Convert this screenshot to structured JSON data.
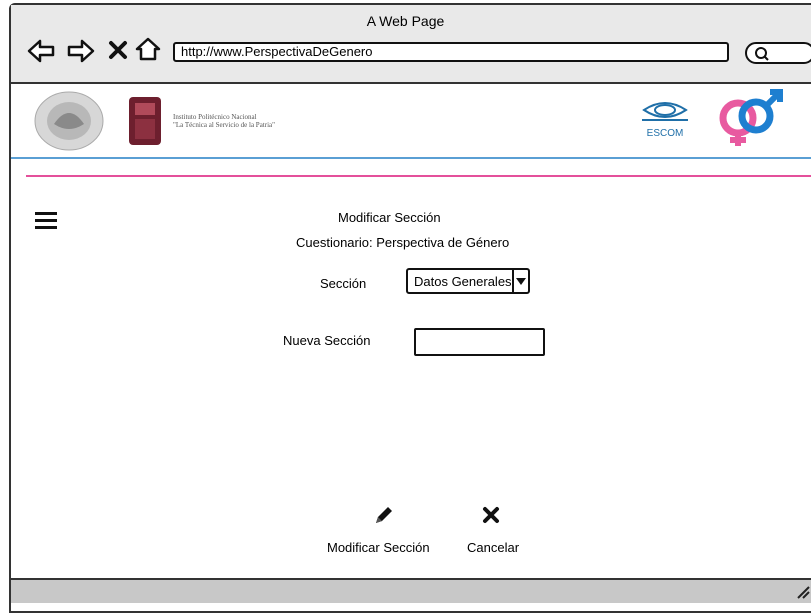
{
  "window": {
    "title": "A Web Page",
    "url": "http://www.PerspectivaDeGenero"
  },
  "header": {
    "institution_line1": "Instituto Politécnico Nacional",
    "institution_line2": "\"La Técnica al Servicio de la Patria\"",
    "escom_label": "ESCOM"
  },
  "main": {
    "heading": "Modificar Sección",
    "subheading": "Cuestionario: Perspectiva de Género",
    "section_label": "Sección",
    "section_selected": "Datos Generales",
    "new_section_label": "Nueva Sección",
    "new_section_value": ""
  },
  "actions": {
    "modify_label": "Modificar Sección",
    "cancel_label": "Cancelar"
  },
  "colors": {
    "accent_blue": "#5a9fd4",
    "accent_pink": "#e4509b",
    "chrome_bg": "#e9e9e9"
  }
}
